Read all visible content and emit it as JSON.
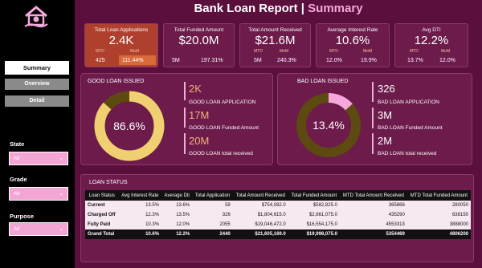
{
  "header": {
    "title": "Bank Loan Report",
    "separator": " | ",
    "subtitle": "Summary"
  },
  "nav": {
    "items": [
      {
        "label": "Summary"
      },
      {
        "label": "Overview"
      },
      {
        "label": "Detail"
      }
    ]
  },
  "filters": [
    {
      "label": "State",
      "value": "All"
    },
    {
      "label": "Grade",
      "value": "All"
    },
    {
      "label": "Purpose",
      "value": "All"
    }
  ],
  "kpis": [
    {
      "title": "Total  Loan Applications",
      "value": "2.4K",
      "mtd_label": "MTD",
      "mom_label": "MoM",
      "mtd": "425",
      "mom": "111.44%"
    },
    {
      "title": "Total Funded Amount",
      "value": "$20.0M",
      "mtd": "5M",
      "mom": "197.31%"
    },
    {
      "title": "Total Amount Received",
      "value": "$21.6M",
      "mtd_label": "MTD",
      "mom_label": "MoM",
      "mtd": "5M",
      "mom": "240.3%"
    },
    {
      "title": "Average Interest Rate",
      "value": "10.6%",
      "mtd_label": "MTD",
      "mom_label": "MoM",
      "mtd": "12.0%",
      "mom": "19.9%"
    },
    {
      "title": "Avg DTI",
      "value": "12.2%",
      "mtd_label": "MTD",
      "mom_label": "MoM",
      "mtd": "13.7%",
      "mom": "12.0%"
    }
  ],
  "good_loan": {
    "title": "GOOD LOAN ISSUED",
    "percent_label": "86.6%",
    "percent_value": 86.6,
    "stats": [
      {
        "value": "2K",
        "label": "GOOD LOAN APPLICATION"
      },
      {
        "value": "17M",
        "label": "GOOD LOAN Funded Amount"
      },
      {
        "value": "20M",
        "label": "GOOD LOAN total received"
      }
    ]
  },
  "bad_loan": {
    "title": "BAD LOAN ISSUED",
    "percent_label": "13.4%",
    "percent_value": 13.4,
    "stats": [
      {
        "value": "326",
        "label": "BAD LOAN APPLICATION"
      },
      {
        "value": "3M",
        "label": "BAD LOAN Funded Amount"
      },
      {
        "value": "2M",
        "label": "BAD LOAN total received"
      }
    ]
  },
  "loan_status": {
    "title": "LOAN STATUS",
    "headers": [
      "Loan Status",
      "Avg Interest Rate",
      "Average Dti",
      "Total Application",
      "Total Amount Received",
      "Total Funded Amount",
      "MTD Total Amount Received",
      "MTD Total Funded Amount"
    ],
    "rows": [
      [
        "Current",
        "13.5%",
        "13.6%",
        "59",
        "$754,082.0",
        "$582,825.0",
        "365866",
        "280050"
      ],
      [
        "Charged Off",
        "12.3%",
        "13.5%",
        "326",
        "$1,804,615.0",
        "$2,861,075.0",
        "435290",
        "638150"
      ],
      [
        "Fully Paid",
        "10.3%",
        "12.0%",
        "2055",
        "$19,046,472.0",
        "$16,554,175.0",
        "4553313",
        "3888000"
      ],
      [
        "Grand Total",
        "10.6%",
        "12.2%",
        "2440",
        "$21,605,169.0",
        "$19,998,075.0",
        "5354469",
        "4806200"
      ]
    ]
  },
  "colors": {
    "background": "#5a0f3c",
    "panel": "#6c1b4b",
    "accent": "#f6a8dc",
    "good_ring": "#f0d070",
    "bad_ring": "#f6a8dc",
    "ring_track": "#5c4a10"
  }
}
